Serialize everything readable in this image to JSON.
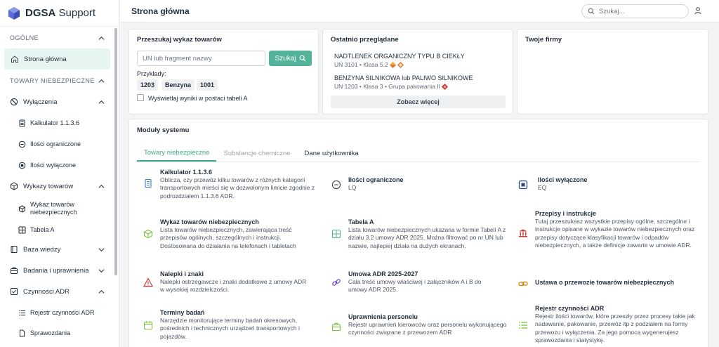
{
  "app": {
    "name_bold": "DGSA",
    "name_light": " Support"
  },
  "colors": {
    "accent": "#53b39a",
    "accent_dark": "#41a98c",
    "hazard_orange": "#e8692c",
    "hazard_red": "#c83b3b"
  },
  "sidebar": {
    "section_general": "OGÓLNE",
    "home": "Strona główna",
    "section_dangerous": "TOWARY NIEBEZPIECZNE",
    "exemptions": "Wyłączenia",
    "calculator": "Kalkulator 1.1.3.6",
    "limited": "Ilości ograniczone",
    "excepted": "Ilości wyłączone",
    "goods_lists": "Wykazy towarów",
    "dg_list": "Wykaz towarów niebezpiecznych",
    "table_a": "Tabela A",
    "knowledge": "Baza wiedzy",
    "research": "Badania i uprawnienia",
    "adr_activities": "Czynności ADR",
    "adr_register": "Rejestr czynności ADR",
    "reports": "Sprawozdania"
  },
  "header": {
    "title": "Strona główna",
    "search_placeholder": "Szukaj..."
  },
  "goods_search": {
    "title": "Przeszukaj wykaz towarów",
    "input_placeholder": "UN lub fragment nazwy",
    "button": "Szukaj",
    "examples_label": "Przykłady:",
    "examples": [
      "1203",
      "Benzyna",
      "1001"
    ],
    "checkbox_label": "Wyświetlaj wyniki w postaci tabeli A"
  },
  "recent": {
    "title": "Ostatnio przeglądane",
    "items": [
      {
        "name": "NADTLENEK ORGANICZNY TYPU B CIEKŁY",
        "meta": "UN 3101 • Klasa 5.2"
      },
      {
        "name": "BENZYNA SILNIKOWA lub PALIWO SILNIKOWE",
        "meta": "UN 1203 • Klasa 3 • Grupa pakowania II"
      }
    ],
    "more": "Zobacz więcej"
  },
  "firms": {
    "title": "Twoje firmy"
  },
  "modules": {
    "title": "Moduły systemu",
    "tabs": [
      "Towary niebezpieczne",
      "Substancje chemiczne",
      "Dane użytkownika"
    ],
    "items": [
      {
        "title": "Kalkulator 1.1.3.6",
        "desc": "Oblicza, czy przewóz kilku towarów z różnych kategorii transportowych mieści się w dozwolonym limicie zgodnie z podrozdziałem 1.1.3.6 ADR.",
        "icon": "calculator-icon"
      },
      {
        "title": "Ilości ograniczone",
        "desc": "LQ",
        "icon": "minus-circle-icon"
      },
      {
        "title": "Ilości wyłączone",
        "desc": "EQ",
        "icon": "stop-square-icon"
      },
      {
        "title": "Wykaz towarów niebezpiecznych",
        "desc": "Lista towarów niebezpiecznych, zawierająca treść przepisów ogólnych, szczególnych i instrukcji. Dostosowana do działania na telefonach i tabletach",
        "icon": "box-icon"
      },
      {
        "title": "Tabela A",
        "desc": "Lista towarów niebezpiecznych ukazana w formie Tabeli A z działu 3.2 umowy ADR 2025. Można filtrować po nr UN lub nazwie, najlepiej działa na dużych ekranach.",
        "icon": "table-icon"
      },
      {
        "title": "Przepisy i instrukcje",
        "desc": "Tutaj przeszukasz wszystkie przepisy ogólne, szczególne i instrukcje opisane w wykazie towarów niebezpiecznych oraz przepisy dotyczące klasyfikacji towarów i odpadów niebezpiecznych, a także definicje zawarte w umowie ADR.",
        "icon": "bank-icon"
      },
      {
        "title": "Nalepki i znaki",
        "desc": "Nalepki ostrzegawcze i znaki dodatkowe z umowy ADR w wysokiej rozdzielczości.",
        "icon": "warning-icon"
      },
      {
        "title": "Umowa ADR 2025-2027",
        "desc": "Cała treść umowy właściwej i załączników A i B do umowy ADR 2025.",
        "icon": "link-icon"
      },
      {
        "title": "Ustawa o przewozie towarów niebezpiecznych",
        "desc": "",
        "icon": "chain-icon"
      },
      {
        "title": "Terminy badań",
        "desc": "Narzędzie monitorujące terminy badań okresowych, pośrednich i technicznych urządzeń transportowych i pojazdów.",
        "icon": "calendar-icon"
      },
      {
        "title": "Uprawnienia personelu",
        "desc": "Rejestr uprawnień kierowców oraz personelu wykonującego czynności związane z przewozem ADR",
        "icon": "briefcase-icon"
      },
      {
        "title": "Rejestr czynności ADR",
        "desc": "Rejestr ilości towarów, które przeszły przez procesy takie jak nadawanie, pakowanie, przewóz itp z podziałem na formy przewozu i wyłączenia. Za jego pomocą wygenerujesz sprawozdania i statystykę.",
        "icon": "list-icon"
      }
    ]
  }
}
